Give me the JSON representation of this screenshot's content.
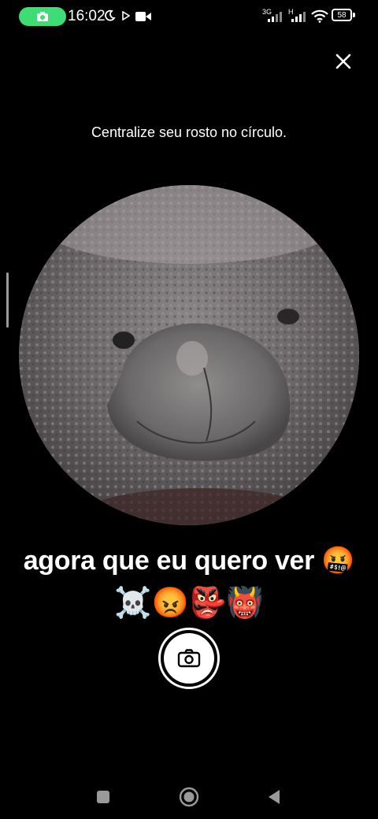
{
  "status_bar": {
    "time": "16:02",
    "battery": "58",
    "signal_1_label": "3G",
    "signal_2_label": "H",
    "icons": [
      "camera-icon",
      "moon-icon",
      "play-icon",
      "video-icon",
      "signal-icon",
      "wifi-icon",
      "battery-icon"
    ]
  },
  "camera": {
    "instruction": "Centralize seu rosto no círculo.",
    "caption_line1": "agora que eu quero ver 🤬",
    "caption_line2": "☠️😡👺👹"
  },
  "colors": {
    "background": "#000000",
    "camera_pill": "#3ddc74",
    "foreground": "#ffffff"
  }
}
